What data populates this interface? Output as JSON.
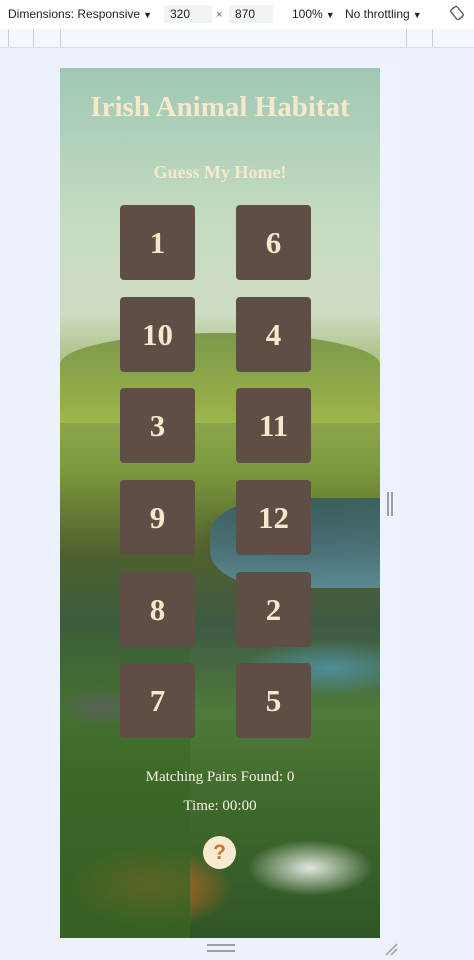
{
  "devtools": {
    "device_label": "Dimensions: Responsive",
    "width_value": "320",
    "times_sign": "×",
    "height_value": "870",
    "zoom_label": "100%",
    "throttling_label": "No throttling",
    "caret": "▼"
  },
  "app": {
    "title": "Irish Animal Habitat",
    "subtitle": "Guess My Home!",
    "cards": [
      "1",
      "6",
      "10",
      "4",
      "3",
      "11",
      "9",
      "12",
      "8",
      "2",
      "7",
      "5"
    ],
    "pairs_found_label": "Matching Pairs Found: 0",
    "time_label": "Time: 00:00",
    "help_label": "?"
  },
  "colors": {
    "card_bg": "#5e4e46",
    "title_text": "#f6e9cb",
    "help_icon": "#c8732e"
  }
}
